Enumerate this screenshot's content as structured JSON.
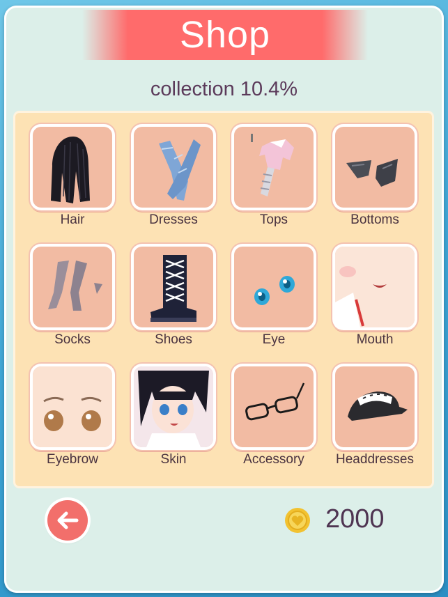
{
  "header": {
    "title": "Shop",
    "collection": "collection 10.4%"
  },
  "categories": [
    {
      "label": "Hair",
      "icon": "hair-icon"
    },
    {
      "label": "Dresses",
      "icon": "dresses-icon"
    },
    {
      "label": "Tops",
      "icon": "tops-icon"
    },
    {
      "label": "Bottoms",
      "icon": "bottoms-icon"
    },
    {
      "label": "Socks",
      "icon": "socks-icon"
    },
    {
      "label": "Shoes",
      "icon": "shoes-icon"
    },
    {
      "label": "Eye",
      "icon": "eye-icon"
    },
    {
      "label": "Mouth",
      "icon": "mouth-icon"
    },
    {
      "label": "Eyebrow",
      "icon": "eyebrow-icon"
    },
    {
      "label": "Skin",
      "icon": "skin-icon"
    },
    {
      "label": "Accessory",
      "icon": "glasses-icon"
    },
    {
      "label": "Headdresses",
      "icon": "cap-icon"
    }
  ],
  "footer": {
    "back_icon": "back-arrow-icon",
    "coin_icon": "coin-icon",
    "coins": "2000"
  },
  "colors": {
    "banner": "#ff6b6b",
    "panel": "#dcefe9",
    "grid": "#fde2b4",
    "tile": "#f2bba3",
    "back_button": "#f26f6b",
    "coin": "#f2c230"
  }
}
